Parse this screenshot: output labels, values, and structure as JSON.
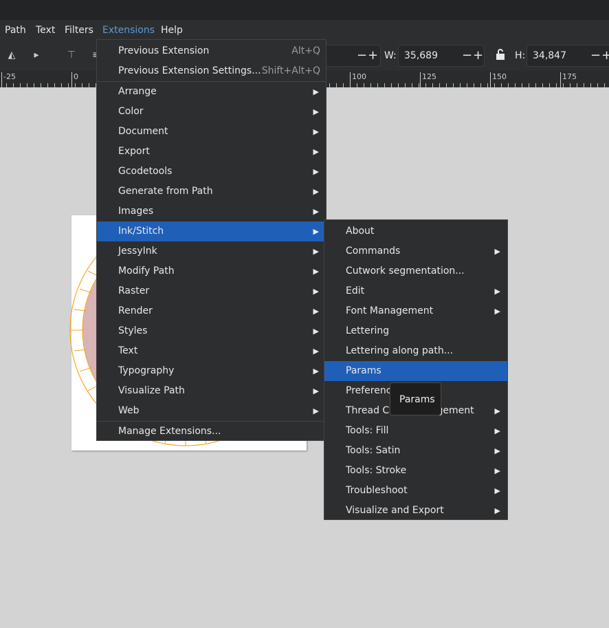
{
  "menubar": {
    "items": [
      "Path",
      "Text",
      "Filters",
      "Extensions",
      "Help"
    ]
  },
  "toolbar": {
    "w_label": "W:",
    "w_value": "35,689",
    "h_label": "H:",
    "h_value": "34,847",
    "minus": "−",
    "plus": "+"
  },
  "ruler": {
    "labels": [
      "-25",
      "0",
      "100",
      "125",
      "150",
      "175"
    ]
  },
  "extensions_menu": {
    "items": [
      {
        "label": "Previous Extension",
        "shortcut": "Alt+Q"
      },
      {
        "label": "Previous Extension Settings...",
        "shortcut": "Shift+Alt+Q"
      },
      {
        "label": "Arrange"
      },
      {
        "label": "Color"
      },
      {
        "label": "Document"
      },
      {
        "label": "Export"
      },
      {
        "label": "Gcodetools"
      },
      {
        "label": "Generate from Path"
      },
      {
        "label": "Images"
      },
      {
        "label": "Ink/Stitch"
      },
      {
        "label": "JessyInk"
      },
      {
        "label": "Modify Path"
      },
      {
        "label": "Raster"
      },
      {
        "label": "Render"
      },
      {
        "label": "Styles"
      },
      {
        "label": "Text"
      },
      {
        "label": "Typography"
      },
      {
        "label": "Visualize Path"
      },
      {
        "label": "Web"
      },
      {
        "label": "Manage Extensions..."
      }
    ]
  },
  "inkstitch_menu": {
    "items": [
      {
        "label": "About"
      },
      {
        "label": "Commands"
      },
      {
        "label": "Cutwork segmentation..."
      },
      {
        "label": "Edit"
      },
      {
        "label": "Font Management"
      },
      {
        "label": "Lettering"
      },
      {
        "label": "Lettering along path..."
      },
      {
        "label": "Params"
      },
      {
        "label": "Preferences"
      },
      {
        "label": "Thread Color Management"
      },
      {
        "label": "Tools: Fill"
      },
      {
        "label": "Tools: Satin"
      },
      {
        "label": "Tools: Stroke"
      },
      {
        "label": "Troubleshoot"
      },
      {
        "label": "Visualize and Export"
      }
    ]
  },
  "tooltip": {
    "text": "Params"
  },
  "colors": {
    "accent": "#1f5fb8",
    "menu_bg": "#2d2e30",
    "canvas_bg": "#d3d3d3",
    "artwork_stroke": "#f5a623",
    "artwork_fill": "#d9b4b4"
  },
  "icons": {
    "submenu_arrow": "▶",
    "lock": "lock-icon"
  }
}
